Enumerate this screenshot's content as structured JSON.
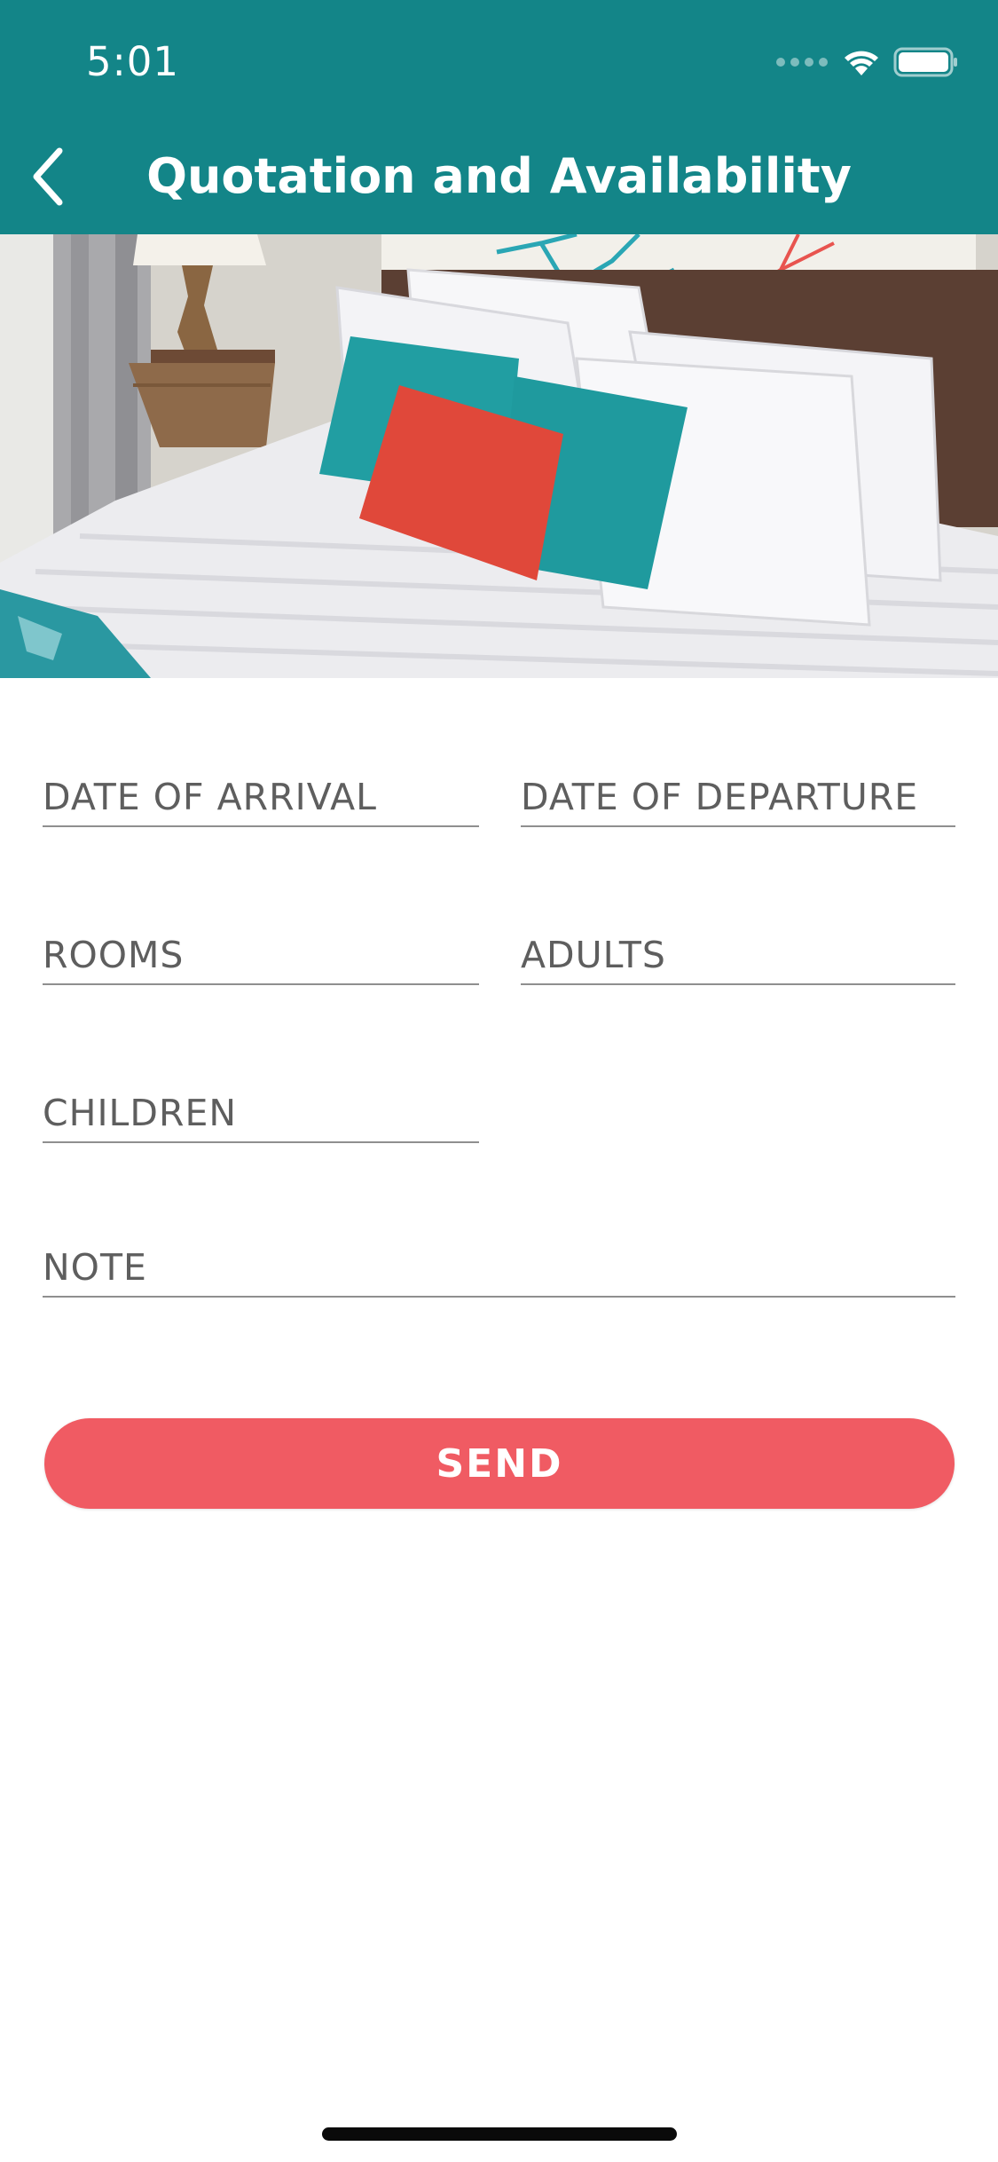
{
  "status_bar": {
    "time": "5:01",
    "icons": [
      "cellular-signal-icon",
      "wifi-icon",
      "battery-icon"
    ]
  },
  "header": {
    "title": "Quotation and Availability",
    "back_icon": "chevron-left-icon",
    "color": "#138588"
  },
  "form": {
    "arrival_placeholder": "DATE OF ARRIVAL",
    "departure_placeholder": "DATE OF DEPARTURE",
    "rooms_placeholder": "ROOMS",
    "adults_placeholder": "ADULTS",
    "children_placeholder": "CHILDREN",
    "note_placeholder": "NOTE",
    "send_label": "SEND",
    "send_color": "#f05b63"
  }
}
